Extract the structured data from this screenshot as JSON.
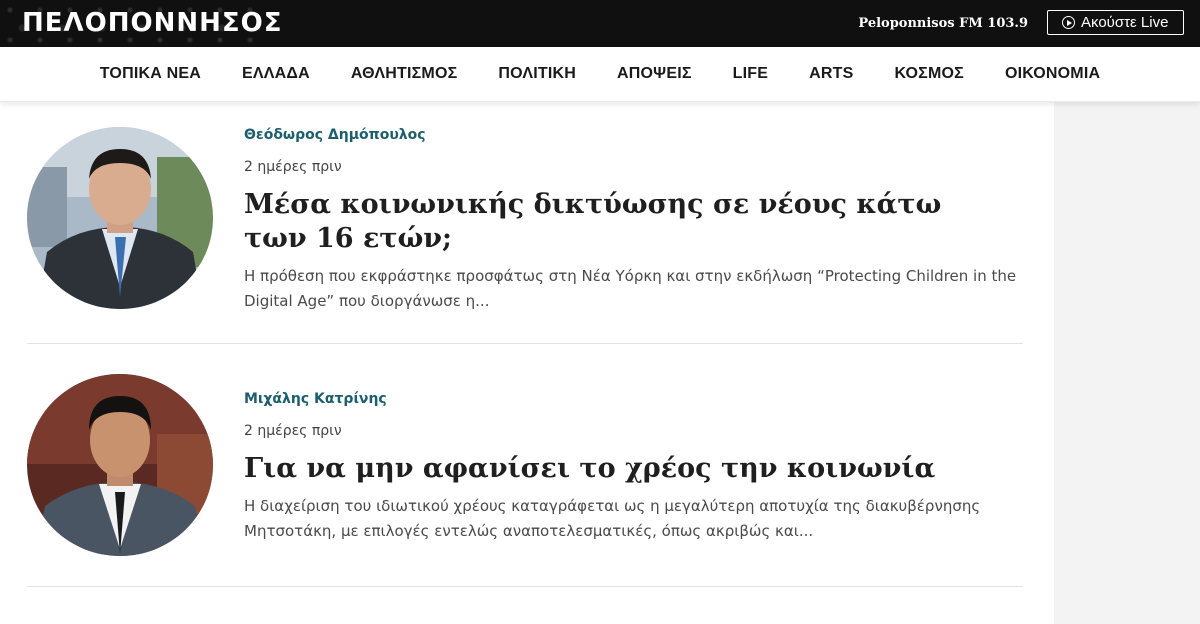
{
  "header": {
    "logo_text": "ΠΕΛΟΠΟΝΝΗΣΟΣ",
    "radio_label": "Peloponnisos FM 103.9",
    "live_button_label": "Ακούστε Live",
    "live_icon": "play-circle-icon"
  },
  "nav": {
    "items": [
      {
        "label": "ΤΟΠΙΚΑ ΝΕΑ"
      },
      {
        "label": "ΕΛΛΑΔΑ"
      },
      {
        "label": "ΑΘΛΗΤΙΣΜΟΣ"
      },
      {
        "label": "ΠΟΛΙΤΙΚΗ"
      },
      {
        "label": "ΑΠΟΨΕΙΣ"
      },
      {
        "label": "LIFE"
      },
      {
        "label": "ARTS"
      },
      {
        "label": "ΚΟΣΜΟΣ"
      },
      {
        "label": "ΟΙΚΟΝΟΜΙΑ"
      }
    ]
  },
  "articles": [
    {
      "author": "Θεόδωρος Δημόπουλος",
      "time": "2 ημέρες πριν",
      "title": "Μέσα κοινωνικής δικτύωσης σε νέους κάτω των 16 ετών;",
      "excerpt": "Η πρόθεση που εκφράστηκε προσφάτως στη Νέα Υόρκη και στην εκδήλωση “Protecting Children in the Digital Age” που διοργάνωσε η..."
    },
    {
      "author": "Μιχάλης Κατρίνης",
      "time": "2 ημέρες πριν",
      "title": "Για να μην αφανίσει το χρέος την κοινωνία",
      "excerpt": "Η διαχείριση του ιδιωτικού χρέους καταγράφεται ως η μεγαλύτερη αποτυχία της διακυβέρνησης Μητσοτάκη, με επιλογές εντελώς αναποτελεσματικές, όπως ακριβώς και..."
    }
  ],
  "colors": {
    "topbar_bg": "#101010",
    "author_accent": "#1c5e6e",
    "headline": "#1f1f1f"
  }
}
